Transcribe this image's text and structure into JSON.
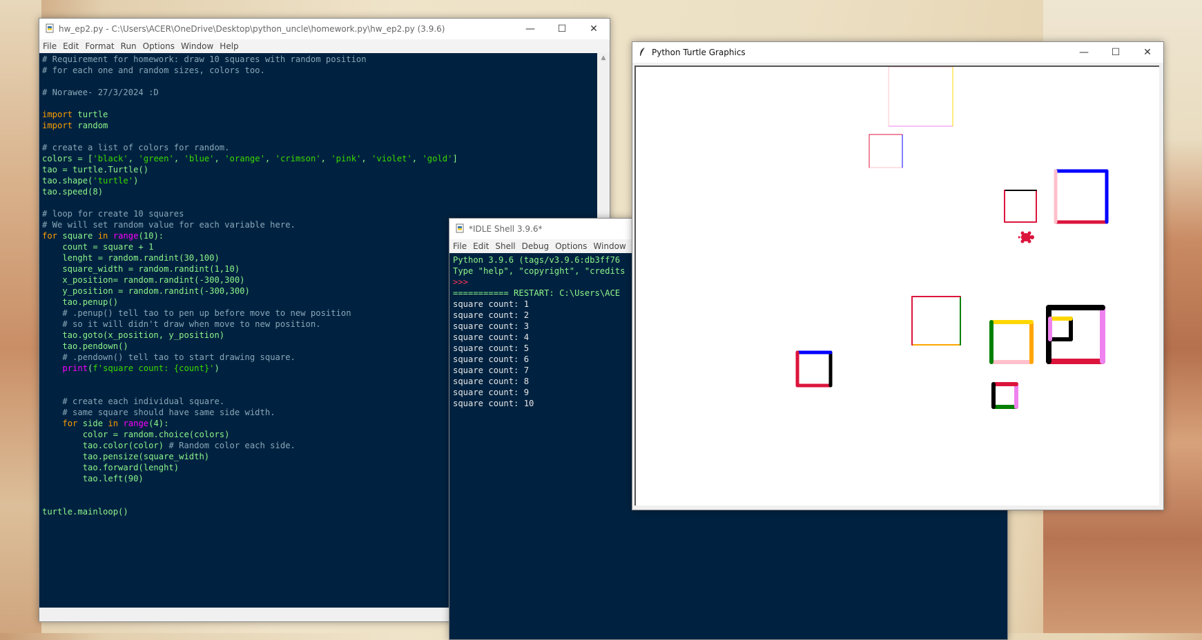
{
  "editor": {
    "title": "hw_ep2.py - C:\\Users\\ACER\\OneDrive\\Desktop\\python_uncle\\homework.py\\hw_ep2.py (3.9.6)",
    "menu": [
      "File",
      "Edit",
      "Format",
      "Run",
      "Options",
      "Window",
      "Help"
    ],
    "lines": [
      [
        [
          "cmt",
          "# Requirement for homework: draw 10 squares with random position"
        ]
      ],
      [
        [
          "cmt",
          "# for each one and random sizes, colors too."
        ]
      ],
      [],
      [
        [
          "cmt",
          "# Norawee- 27/3/2024 :D"
        ]
      ],
      [],
      [
        [
          "kw",
          "import"
        ],
        [
          "df",
          " turtle"
        ]
      ],
      [
        [
          "kw",
          "import"
        ],
        [
          "df",
          " random"
        ]
      ],
      [],
      [
        [
          "cmt",
          "# create a list of colors for random."
        ]
      ],
      [
        [
          "df",
          "colors = ["
        ],
        [
          "st",
          "'black'"
        ],
        [
          "df",
          ", "
        ],
        [
          "st",
          "'green'"
        ],
        [
          "df",
          ", "
        ],
        [
          "st",
          "'blue'"
        ],
        [
          "df",
          ", "
        ],
        [
          "st",
          "'orange'"
        ],
        [
          "df",
          ", "
        ],
        [
          "st",
          "'crimson'"
        ],
        [
          "df",
          ", "
        ],
        [
          "st",
          "'pink'"
        ],
        [
          "df",
          ", "
        ],
        [
          "st",
          "'violet'"
        ],
        [
          "df",
          ", "
        ],
        [
          "st",
          "'gold'"
        ],
        [
          "df",
          "]"
        ]
      ],
      [
        [
          "df",
          "tao = turtle.Turtle()"
        ]
      ],
      [
        [
          "df",
          "tao.shape("
        ],
        [
          "st",
          "'turtle'"
        ],
        [
          "df",
          ")"
        ]
      ],
      [
        [
          "df",
          "tao.speed(8)"
        ]
      ],
      [],
      [
        [
          "cmt",
          "# loop for create 10 squares"
        ]
      ],
      [
        [
          "cmt",
          "# We will set random value for each variable here."
        ]
      ],
      [
        [
          "kw",
          "for"
        ],
        [
          "df",
          " square "
        ],
        [
          "kw",
          "in"
        ],
        [
          "df",
          " "
        ],
        [
          "bi",
          "range"
        ],
        [
          "df",
          "(10):"
        ]
      ],
      [
        [
          "df",
          "    count = square + 1"
        ]
      ],
      [
        [
          "df",
          "    lenght = random.randint(30,100)"
        ]
      ],
      [
        [
          "df",
          "    square_width = random.randint(1,10)"
        ]
      ],
      [
        [
          "df",
          "    x_position= random.randint(-300,300)"
        ]
      ],
      [
        [
          "df",
          "    y_position = random.randint(-300,300)"
        ]
      ],
      [
        [
          "df",
          "    tao.penup()"
        ]
      ],
      [
        [
          "df",
          "    "
        ],
        [
          "cmt",
          "# .penup() tell tao to pen up before move to new position"
        ]
      ],
      [
        [
          "df",
          "    "
        ],
        [
          "cmt",
          "# so it will didn't draw when move to new position."
        ]
      ],
      [
        [
          "df",
          "    tao.goto(x_position, y_position)"
        ]
      ],
      [
        [
          "df",
          "    tao.pendown()"
        ]
      ],
      [
        [
          "df",
          "    "
        ],
        [
          "cmt",
          "# .pendown() tell tao to start drawing square."
        ]
      ],
      [
        [
          "df",
          "    "
        ],
        [
          "bi",
          "print"
        ],
        [
          "df",
          "("
        ],
        [
          "st",
          "f'square count: {count}'"
        ],
        [
          "df",
          ")"
        ]
      ],
      [],
      [],
      [
        [
          "df",
          "    "
        ],
        [
          "cmt",
          "# create each individual square."
        ]
      ],
      [
        [
          "df",
          "    "
        ],
        [
          "cmt",
          "# same square should have same side width."
        ]
      ],
      [
        [
          "df",
          "    "
        ],
        [
          "kw",
          "for"
        ],
        [
          "df",
          " side "
        ],
        [
          "kw",
          "in"
        ],
        [
          "df",
          " "
        ],
        [
          "bi",
          "range"
        ],
        [
          "df",
          "(4):"
        ]
      ],
      [
        [
          "df",
          "        color = random.choice(colors)"
        ]
      ],
      [
        [
          "df",
          "        tao.color(color) "
        ],
        [
          "cmt",
          "# Random color each side."
        ]
      ],
      [
        [
          "df",
          "        tao.pensize(square_width)"
        ]
      ],
      [
        [
          "df",
          "        tao.forward(lenght)"
        ]
      ],
      [
        [
          "df",
          "        tao.left(90)"
        ]
      ],
      [],
      [],
      [
        [
          "df",
          "turtle.mainloop()"
        ]
      ]
    ]
  },
  "shell": {
    "title": "*IDLE Shell 3.9.6*",
    "menu": [
      "File",
      "Edit",
      "Shell",
      "Debug",
      "Options",
      "Window",
      "Help"
    ],
    "lines": [
      [
        [
          "df",
          "Python 3.9.6 (tags/v3.9.6:db3ff76"
        ]
      ],
      [
        [
          "df",
          "Type \"help\", \"copyright\", \"credits"
        ]
      ],
      [
        [
          "prm",
          ">>>"
        ]
      ],
      [
        [
          "df",
          "=========== RESTART: C:\\Users\\ACE"
        ]
      ],
      [
        [
          "out",
          "square count: 1"
        ]
      ],
      [
        [
          "out",
          "square count: 2"
        ]
      ],
      [
        [
          "out",
          "square count: 3"
        ]
      ],
      [
        [
          "out",
          "square count: 4"
        ]
      ],
      [
        [
          "out",
          "square count: 5"
        ]
      ],
      [
        [
          "out",
          "square count: 6"
        ]
      ],
      [
        [
          "out",
          "square count: 7"
        ]
      ],
      [
        [
          "out",
          "square count: 8"
        ]
      ],
      [
        [
          "out",
          "square count: 9"
        ]
      ],
      [
        [
          "out",
          "square count: 10"
        ]
      ]
    ]
  },
  "turtle": {
    "title": "Python Turtle Graphics",
    "squares": [
      {
        "w": 1,
        "sides": [
          "#ee82ee",
          "#ffd700",
          "#ffc0cb",
          "#ffc0cb"
        ]
      },
      {
        "w": 1,
        "sides": [
          "#ffc0cb",
          "#0000ff",
          "#dc143c",
          "#dc143c"
        ]
      },
      {
        "w": 2,
        "sides": [
          "#dc143c",
          "#dc143c",
          "#000000",
          "#dc143c"
        ]
      },
      {
        "w": 5,
        "sides": [
          "#dc143c",
          "#0000ff",
          "#0000ff",
          "#ffc0cb"
        ]
      },
      {
        "w": 2,
        "sides": [
          "#ffa500",
          "#008000",
          "#dc143c",
          "#dc143c"
        ]
      },
      {
        "w": 6,
        "sides": [
          "#ffc0cb",
          "#ffa500",
          "#ffd700",
          "#008000"
        ]
      },
      {
        "w": 8,
        "sides": [
          "#dc143c",
          "#ee82ee",
          "#000000",
          "#000000"
        ]
      },
      {
        "w": 6,
        "sides": [
          "#000000",
          "#000000",
          "#ffd700",
          "#ee82ee"
        ]
      },
      {
        "w": 6,
        "sides": [
          "#008000",
          "#ee82ee",
          "#dc143c",
          "#000000"
        ]
      },
      {
        "w": 5,
        "sides": [
          "#dc143c",
          "#000000",
          "#0000ff",
          "#dc143c"
        ]
      }
    ]
  }
}
